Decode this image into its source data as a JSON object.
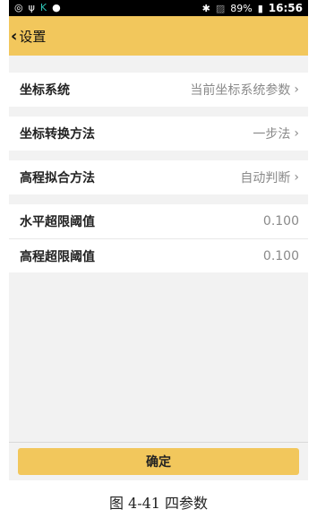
{
  "status_bar": {
    "battery": "89%",
    "time": "16:56",
    "icons_left": [
      "settings-icon",
      "usb-icon",
      "app-icon",
      "android-icon"
    ],
    "icons_right": [
      "bluetooth-icon",
      "no-signal-icon",
      "battery-icon"
    ]
  },
  "header": {
    "back_label": "设置"
  },
  "settings": {
    "coord_system": {
      "label": "坐标系统",
      "value": "当前坐标系统参数"
    },
    "coord_transform": {
      "label": "坐标转换方法",
      "value": "一步法"
    },
    "elevation_fit": {
      "label": "高程拟合方法",
      "value": "自动判断"
    },
    "horizontal_limit": {
      "label": "水平超限阈值",
      "value": "0.100"
    },
    "elevation_limit": {
      "label": "高程超限阈值",
      "value": "0.100"
    }
  },
  "confirm_label": "确定",
  "caption": "图 4-41 四参数",
  "colors": {
    "accent": "#f2c75c",
    "background": "#f2f2f2"
  }
}
